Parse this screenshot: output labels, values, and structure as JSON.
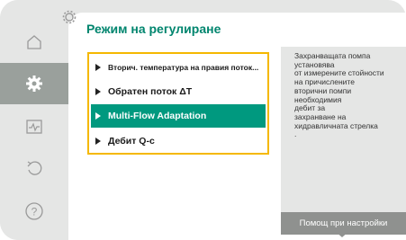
{
  "sidebar": {
    "items": [
      {
        "icon": "home-icon"
      },
      {
        "icon": "gear-icon"
      },
      {
        "icon": "diagnostics-icon"
      },
      {
        "icon": "undo-icon"
      },
      {
        "icon": "help-icon"
      }
    ],
    "active_index": 1
  },
  "header": {
    "title": "Режим на регулиране"
  },
  "menu": {
    "items": [
      {
        "label": "Вторич. температура на правия поток..."
      },
      {
        "label": "Обратен поток ΔT"
      },
      {
        "label": "Multi-Flow Adaptation"
      },
      {
        "label": "Дебит Q-c"
      }
    ],
    "selected_index": 2
  },
  "help_panel": {
    "text": "Захранващата помпа\nустановява\nот измерените стойности\nна причислените\nвторични помпи\nнеобходимия\nдебит за\nзахранване на\nхидравличната стрелка\n.",
    "button_label": "Помощ при настройки"
  },
  "colors": {
    "accent": "#00997f",
    "title": "#00856e",
    "focus_border": "#f5b800",
    "panel_bg": "#e5e6e5"
  }
}
